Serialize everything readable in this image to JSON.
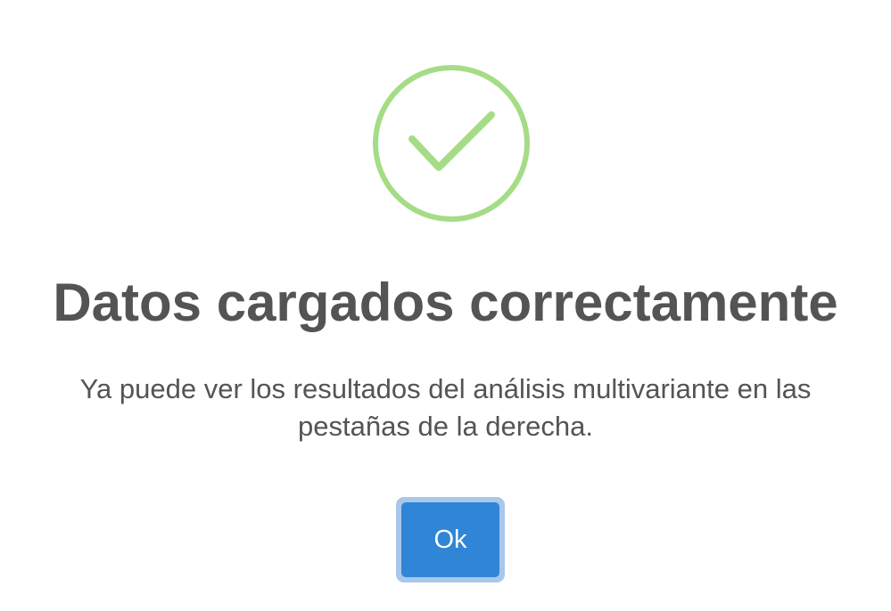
{
  "dialog": {
    "icon": "success-check-icon",
    "icon_color": "#a5dc86",
    "title": "Datos cargados correctamente",
    "message": "Ya puede ver los resultados del análisis multivariante en las pestañas de la derecha.",
    "confirm_label": "Ok",
    "confirm_color": "#3085d6",
    "text_color": "#545454"
  }
}
